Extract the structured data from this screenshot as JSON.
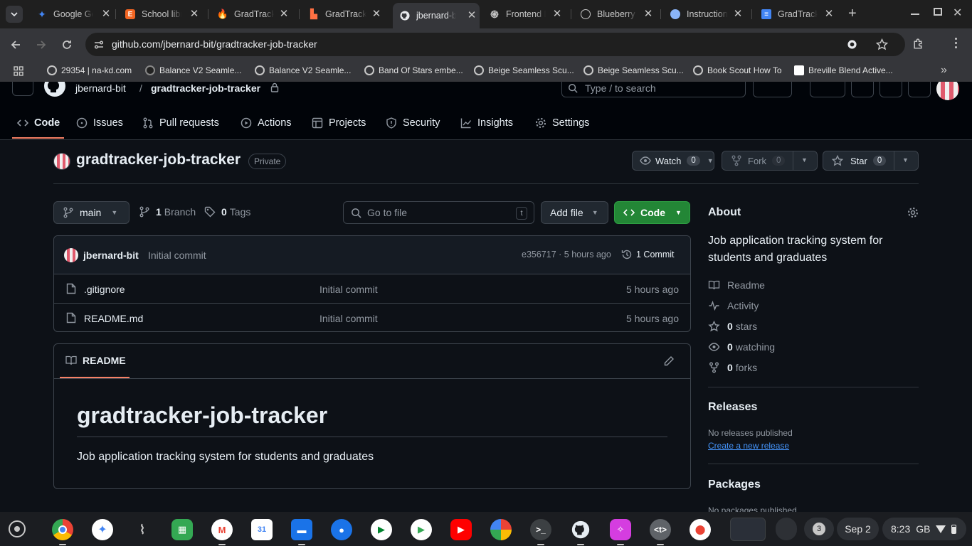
{
  "browser": {
    "tabs": [
      {
        "title": "Google Gemini",
        "icon": "gemini-icon",
        "color": "#4285f4"
      },
      {
        "title": "School library",
        "icon": "e-icon",
        "color": "#f26522"
      },
      {
        "title": "GradTracker",
        "icon": "fire-icon",
        "color": "#f4511e"
      },
      {
        "title": "GradTracker",
        "icon": "bolt-icon",
        "color": "#ff7043"
      },
      {
        "title": "jbernard-bit/gradtracker-job-tracker",
        "icon": "github-icon",
        "color": "#e6edf3"
      },
      {
        "title": "Frontend Development",
        "icon": "openai-icon",
        "color": "#c7c7c7"
      },
      {
        "title": "Blueberry Design",
        "icon": "chat-icon",
        "color": "#c7c7c7"
      },
      {
        "title": "Instructions",
        "icon": "eye-icon",
        "color": "#8ab4f8"
      },
      {
        "title": "GradTracker",
        "icon": "docs-icon",
        "color": "#4285f4"
      }
    ],
    "url": "github.com/jbernard-bit/gradtracker-job-tracker",
    "bookmarks": [
      "29354 | na-kd.com",
      "Balance V2 Seamle...",
      "Balance V2 Seamle...",
      "Band Of Stars embe...",
      "Beige Seamless Scu...",
      "Beige Seamless Scu...",
      "Book Scout How To",
      "Breville Blend Active..."
    ]
  },
  "github": {
    "owner": "jbernard-bit",
    "repo": "gradtracker-job-tracker",
    "search_placeholder": "Type / to search",
    "nav": [
      "Code",
      "Issues",
      "Pull requests",
      "Actions",
      "Projects",
      "Security",
      "Insights",
      "Settings"
    ],
    "visibility": "Private",
    "watch": {
      "label": "Watch",
      "count": "0"
    },
    "fork": {
      "label": "Fork",
      "count": "0"
    },
    "star": {
      "label": "Star",
      "count": "0"
    },
    "branch": "main",
    "branch_count": "1",
    "branch_label": "Branch",
    "tag_count": "0",
    "tag_label": "Tags",
    "goto_placeholder": "Go to file",
    "goto_key": "t",
    "add_file": "Add file",
    "code_button": "Code",
    "commit": {
      "author": "jbernard-bit",
      "message": "Initial commit",
      "meta": "e356717 · 5 hours ago",
      "count": "1 Commit"
    },
    "files": [
      {
        "name": ".gitignore",
        "message": "Initial commit",
        "age": "5 hours ago"
      },
      {
        "name": "README.md",
        "message": "Initial commit",
        "age": "5 hours ago"
      }
    ],
    "readme": {
      "tab": "README",
      "heading": "gradtracker-job-tracker",
      "body": "Job application tracking system for students and graduates"
    },
    "about": {
      "title": "About",
      "description": "Job application tracking system for students and graduates",
      "readme": "Readme",
      "activity": "Activity",
      "stars": "0",
      "stars_label": "stars",
      "watching": "0",
      "watching_label": "watching",
      "forks": "0",
      "forks_label": "forks"
    },
    "releases": {
      "title": "Releases",
      "none": "No releases published",
      "create": "Create a new release"
    },
    "packages": {
      "title": "Packages",
      "none": "No packages published"
    }
  },
  "shelf": {
    "notification_count": "3",
    "date": "Sep 2",
    "time": "8:23",
    "locale": "GB"
  }
}
